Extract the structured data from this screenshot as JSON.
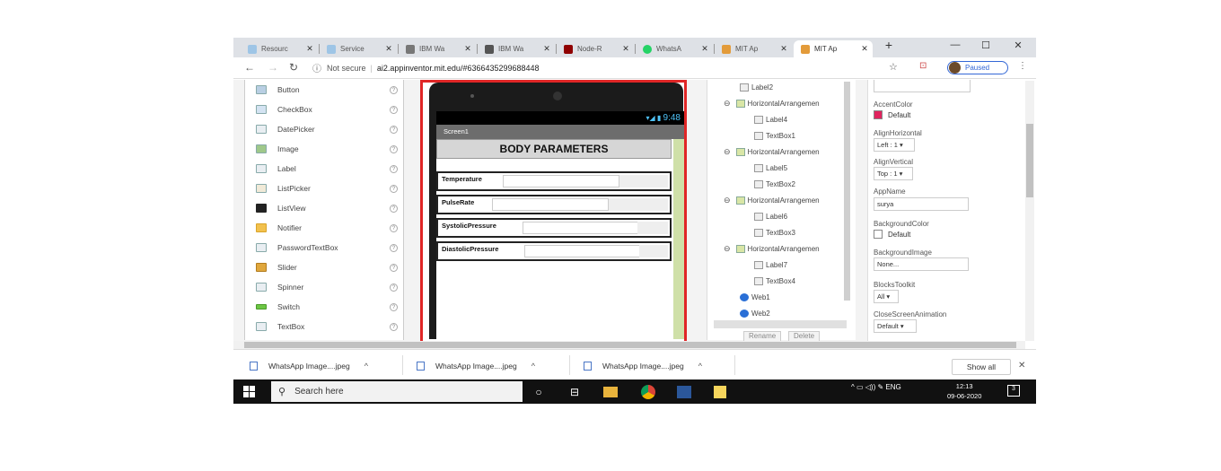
{
  "browser": {
    "tabs": [
      {
        "label": "Resourc",
        "icon_color": "#9ec5e6"
      },
      {
        "label": "Service",
        "icon_color": "#9ec5e6"
      },
      {
        "label": "IBM Wa",
        "icon_color": "#777777"
      },
      {
        "label": "IBM Wa",
        "icon_color": "#555555"
      },
      {
        "label": "Node-R",
        "icon_color": "#8f0000"
      },
      {
        "label": "WhatsA",
        "icon_color": "#25d366"
      },
      {
        "label": "MIT Ap",
        "icon_color": "#e39b3a"
      },
      {
        "label": "MIT Ap",
        "icon_color": "#e39b3a"
      }
    ],
    "active_tab_index": 7,
    "new_tab": "+",
    "close_glyph": "✕",
    "minimize": "—",
    "maximize": "☐",
    "close_window": "✕",
    "not_secure": "Not secure",
    "url": "ai2.appinventor.mit.edu/#6366435299688448",
    "profile_status": "Paused"
  },
  "palette": {
    "items": [
      {
        "label": "Button"
      },
      {
        "label": "CheckBox"
      },
      {
        "label": "DatePicker"
      },
      {
        "label": "Image"
      },
      {
        "label": "Label"
      },
      {
        "label": "ListPicker"
      },
      {
        "label": "ListView"
      },
      {
        "label": "Notifier"
      },
      {
        "label": "PasswordTextBox"
      },
      {
        "label": "Slider"
      },
      {
        "label": "Spinner"
      },
      {
        "label": "Switch"
      },
      {
        "label": "TextBox"
      }
    ],
    "help_glyph": "?"
  },
  "viewer": {
    "time": "9:48",
    "screen_title": "Screen1",
    "heading": "BODY PARAMETERS",
    "rows": [
      {
        "label": "Temperature"
      },
      {
        "label": "PulseRate"
      },
      {
        "label": "SystolicPressure"
      },
      {
        "label": "DiastolicPressure"
      }
    ]
  },
  "components": {
    "items": [
      {
        "label": "Label2",
        "type": "label"
      },
      {
        "label": "HorizontalArrangemen",
        "type": "ha"
      },
      {
        "label": "Label4",
        "type": "label"
      },
      {
        "label": "TextBox1",
        "type": "textbox"
      },
      {
        "label": "HorizontalArrangemen",
        "type": "ha"
      },
      {
        "label": "Label5",
        "type": "label"
      },
      {
        "label": "TextBox2",
        "type": "textbox"
      },
      {
        "label": "HorizontalArrangemen",
        "type": "ha"
      },
      {
        "label": "Label6",
        "type": "label"
      },
      {
        "label": "TextBox3",
        "type": "textbox"
      },
      {
        "label": "HorizontalArrangemen",
        "type": "ha"
      },
      {
        "label": "Label7",
        "type": "label"
      },
      {
        "label": "TextBox4",
        "type": "textbox"
      },
      {
        "label": "Web1",
        "type": "web"
      },
      {
        "label": "Web2",
        "type": "web"
      }
    ],
    "collapse_glyph": "⊖",
    "rename_button": "Rename",
    "delete_button": "Delete"
  },
  "properties": {
    "accent_color_label": "AccentColor",
    "accent_color_value": "Default",
    "accent_color_hex": "#e0245e",
    "align_horizontal_label": "AlignHorizontal",
    "align_horizontal_value": "Left : 1 ▾",
    "align_vertical_label": "AlignVertical",
    "align_vertical_value": "Top : 1 ▾",
    "app_name_label": "AppName",
    "app_name_value": "surya",
    "bg_color_label": "BackgroundColor",
    "bg_color_value": "Default",
    "bg_image_label": "BackgroundImage",
    "bg_image_value": "None...",
    "blocks_toolkit_label": "BlocksToolkit",
    "blocks_toolkit_value": "All ▾",
    "close_anim_label": "CloseScreenAnimation",
    "close_anim_value": "Default ▾"
  },
  "downloads": {
    "items": [
      {
        "label": "WhatsApp Image....jpeg"
      },
      {
        "label": "WhatsApp Image....jpeg"
      },
      {
        "label": "WhatsApp Image....jpeg"
      }
    ],
    "caret": "^",
    "show_all": "Show all",
    "close": "✕"
  },
  "taskbar": {
    "search_placeholder": "Search here",
    "tray_text": "^ ▭ ◁)) ✎ ENG",
    "time": "12:13",
    "date": "09-06-2020",
    "notification_count": "3"
  }
}
